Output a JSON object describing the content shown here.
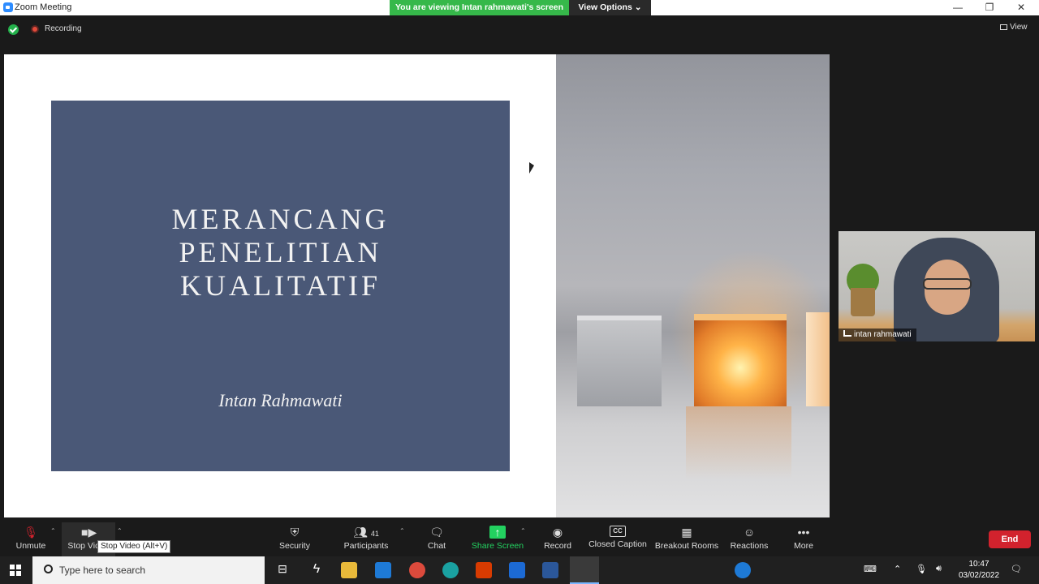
{
  "window": {
    "title": "Zoom Meeting",
    "banner": "You are viewing Intan rahmawati's screen",
    "view_options": "View Options",
    "minimize": "—",
    "restore": "❐",
    "close": "✕"
  },
  "meeting_top": {
    "recording_label": "Recording",
    "view_label": "View"
  },
  "slide": {
    "title_lines": [
      "MERANCANG",
      "PENELITIAN",
      "KUALITATIF"
    ],
    "author": "Intan Rahmawati"
  },
  "participant_video": {
    "name": "intan rahmawati"
  },
  "toolbar": {
    "unmute": "Unmute",
    "stop_video": "Stop Video",
    "stop_video_tooltip": "Stop Video (Alt+V)",
    "security": "Security",
    "participants": "Participants",
    "participants_count": "41",
    "chat": "Chat",
    "share_screen": "Share Screen",
    "record": "Record",
    "closed_caption": "Closed Caption",
    "closed_caption_icon": "CC",
    "breakout_rooms": "Breakout Rooms",
    "reactions": "Reactions",
    "more": "More",
    "end": "End"
  },
  "taskbar": {
    "search_placeholder": "Type here to search",
    "time": "10:47",
    "date": "03/02/2022"
  },
  "colors": {
    "accent_green": "#23d160",
    "end_red": "#d2222d",
    "slide_blue": "#4a5877"
  }
}
